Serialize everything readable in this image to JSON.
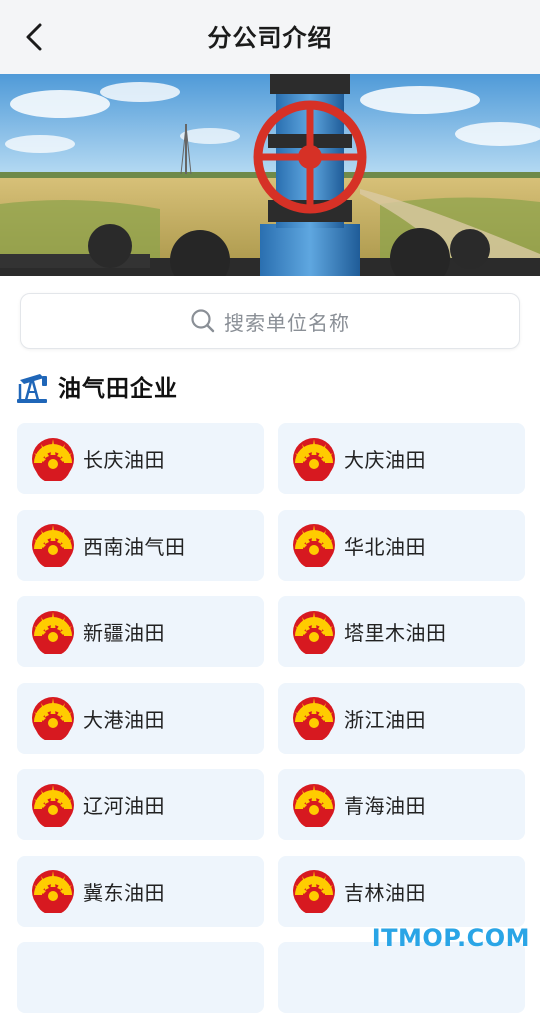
{
  "header": {
    "title": "分公司介绍"
  },
  "search": {
    "placeholder": "搜索单位名称"
  },
  "section": {
    "title": "油气田企业"
  },
  "companies": [
    "长庆油田",
    "大庆油田",
    "西南油气田",
    "华北油田",
    "新疆油田",
    "塔里木油田",
    "大港油田",
    "浙江油田",
    "辽河油田",
    "青海油田",
    "冀东油田",
    "吉林油田"
  ],
  "colors": {
    "card_bg": "#eef5fc",
    "logo_red": "#d71920",
    "logo_yellow": "#ffcc00",
    "watermark": "#2aa5e6"
  },
  "watermark": "ITMOP.COM"
}
